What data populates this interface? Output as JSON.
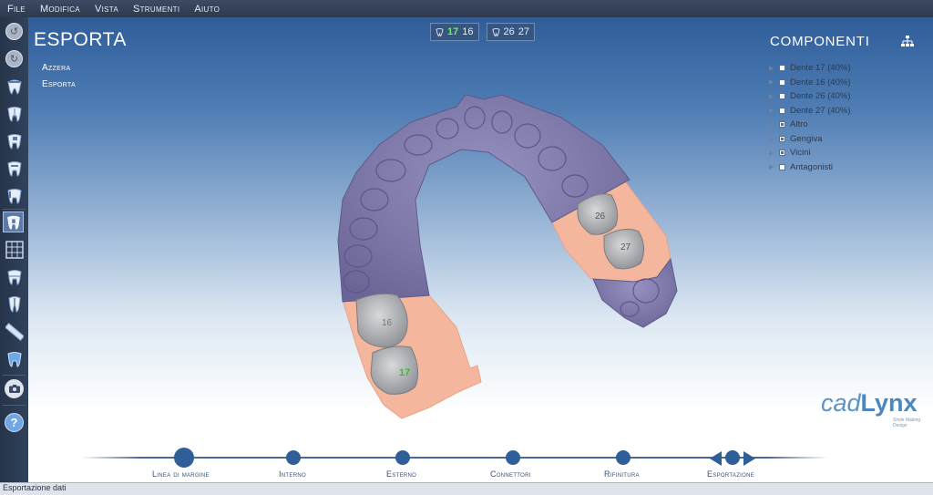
{
  "menu": [
    "File",
    "Modifica",
    "Vista",
    "Strumenti",
    "Aiuto"
  ],
  "page": {
    "title": "ESPORTA",
    "options": [
      "Azzera",
      "Esporta"
    ]
  },
  "tooth_selectors": [
    {
      "primary": "17",
      "secondary": "16"
    },
    {
      "primary": "26",
      "secondary": "27"
    }
  ],
  "components": {
    "title": "COMPONENTI",
    "items": [
      {
        "label": "Dente 17 (40%)",
        "checked": false
      },
      {
        "label": "Dente 16 (40%)",
        "checked": false
      },
      {
        "label": "Dente 26 (40%)",
        "checked": false
      },
      {
        "label": "Dente 27 (40%)",
        "checked": false
      },
      {
        "label": "Altro",
        "checked": true
      },
      {
        "label": "Gengiva",
        "checked": true
      },
      {
        "label": "Vicini",
        "checked": true
      },
      {
        "label": "Antagonisti",
        "checked": false
      }
    ]
  },
  "model": {
    "tooth_labels": [
      "26",
      "27",
      "16",
      "17"
    ]
  },
  "workflow": {
    "steps": [
      "Linea di margine",
      "Interno",
      "Esterno",
      "Connettori",
      "Rifinitura",
      "Esportazione"
    ],
    "current": "Linea di margine"
  },
  "logo": {
    "part1": "cad",
    "part2": "Lynx",
    "tagline": "Smile Making Design"
  },
  "status": "Esportazione dati",
  "colors": {
    "accent": "#2f5e99",
    "gum": "#f2b49a",
    "model": "#7f7aa6",
    "tooth": "#b9bbbf",
    "selected_tooth": "#22cc22"
  }
}
